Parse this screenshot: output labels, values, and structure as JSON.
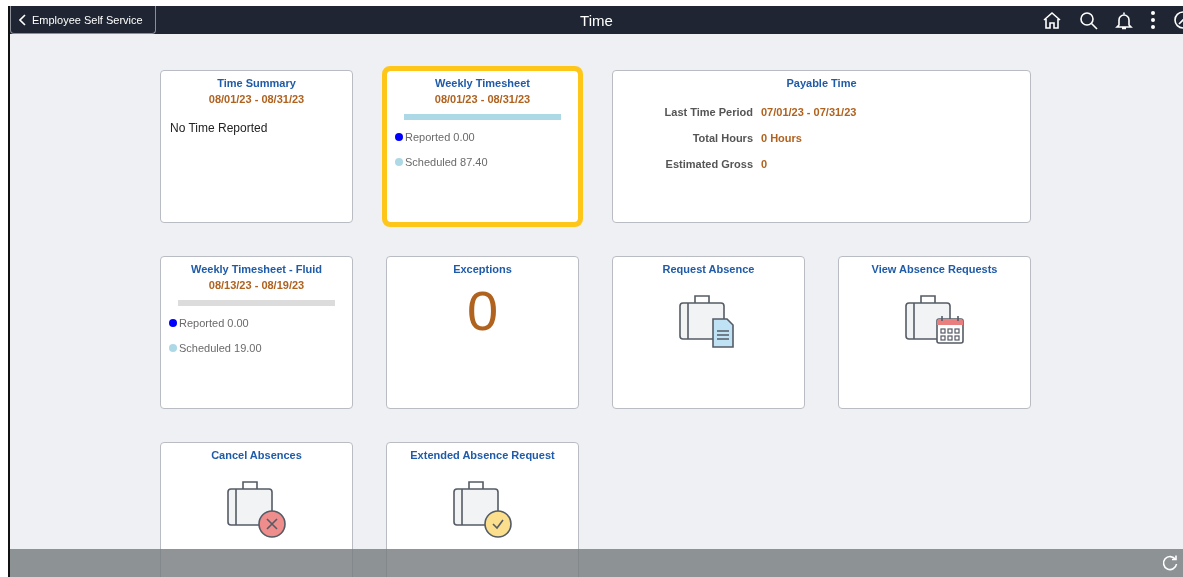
{
  "header": {
    "back_button": "Employee Self Service",
    "title": "Time"
  },
  "tiles": [
    {
      "kind": "summary",
      "title": "Time Summary",
      "period": "08/01/23 - 08/31/23",
      "message": "No Time Reported",
      "selected": false
    },
    {
      "kind": "timesheet",
      "title": "Weekly Timesheet",
      "period": "08/01/23 - 08/31/23",
      "level": 1,
      "legend": [
        {
          "label": "Reported 0.00",
          "color": "#0000ff"
        },
        {
          "label": "Scheduled 87.40",
          "color": "#add8e6"
        }
      ],
      "selected": true
    },
    {
      "kind": "payable",
      "title": "Payable Time",
      "rows": [
        {
          "label": "Last Time Period",
          "value": "07/01/23 - 07/31/23"
        },
        {
          "label": "Total Hours",
          "value": "0 Hours"
        },
        {
          "label": "Estimated Gross",
          "value": "0"
        }
      ],
      "selected": false
    },
    {
      "kind": "timesheet",
      "title": "Weekly Timesheet - Fluid",
      "period": "08/13/23 - 08/19/23",
      "level": 0,
      "legend": [
        {
          "label": "Reported 0.00",
          "color": "#0000ff"
        },
        {
          "label": "Scheduled 19.00",
          "color": "#add8e6"
        }
      ],
      "selected": false
    },
    {
      "kind": "count",
      "title": "Exceptions",
      "count": "0",
      "selected": false
    },
    {
      "kind": "icon",
      "title": "Request Absence",
      "icon": {
        "kind": "document"
      },
      "selected": false
    },
    {
      "kind": "icon",
      "title": "View Absence Requests",
      "icon": {
        "kind": "calendar"
      },
      "selected": false
    },
    {
      "kind": "icon",
      "title": "Cancel Absences",
      "icon": {
        "kind": "cancel"
      },
      "selected": false
    },
    {
      "kind": "icon",
      "title": "Extended Absence Request",
      "icon": {
        "kind": "clock"
      },
      "selected": false
    }
  ]
}
